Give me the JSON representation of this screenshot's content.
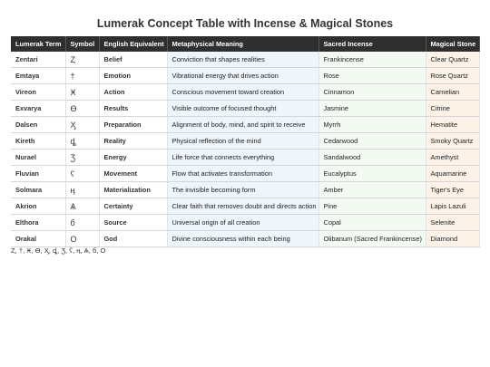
{
  "title": "Lumerak Concept Table with Incense & Magical Stones",
  "table": {
    "headers": [
      "Lumerak Term",
      "Symbol",
      "English Equivalent",
      "Metaphysical Meaning",
      "Sacred Incense",
      "Magical Stone"
    ],
    "rows": [
      {
        "term": "Zentari",
        "symbol": "Ȥ",
        "equiv": "Belief",
        "meaning": "Conviction that shapes realities",
        "incense": "Frankincense",
        "stone": "Clear Quartz"
      },
      {
        "term": "Emtaya",
        "symbol": "†",
        "equiv": "Emotion",
        "meaning": "Vibrational energy that drives action",
        "incense": "Rose",
        "stone": "Rose Quartz"
      },
      {
        "term": "Vireon",
        "symbol": "Ӿ",
        "equiv": "Action",
        "meaning": "Conscious movement toward creation",
        "incense": "Cinnamon",
        "stone": "Carnelian"
      },
      {
        "term": "Exvarya",
        "symbol": "ϴ",
        "equiv": "Results",
        "meaning": "Visible outcome of focused thought",
        "incense": "Jasmine",
        "stone": "Citrine"
      },
      {
        "term": "Dalsen",
        "symbol": "Ӽ",
        "equiv": "Preparation",
        "meaning": "Alignment of body, mind, and spirit to receive",
        "incense": "Myrrh",
        "stone": "Hematite"
      },
      {
        "term": "Kireth",
        "symbol": "ȡ",
        "equiv": "Reality",
        "meaning": "Physical reflection of the mind",
        "incense": "Cedarwood",
        "stone": "Smoky Quartz"
      },
      {
        "term": "Nurael",
        "symbol": "Ʒ",
        "equiv": "Energy",
        "meaning": "Life force that connects everything",
        "incense": "Sandalwood",
        "stone": "Amethyst"
      },
      {
        "term": "Fluvian",
        "symbol": "ʕ",
        "equiv": "Movement",
        "meaning": "Flow that activates transformation",
        "incense": "Eucalyptus",
        "stone": "Aquamarine"
      },
      {
        "term": "Solmara",
        "symbol": "ӊ",
        "equiv": "Materialization",
        "meaning": "The invisible becoming form",
        "incense": "Amber",
        "stone": "Tiger's Eye"
      },
      {
        "term": "Akrion",
        "symbol": "Ѧ",
        "equiv": "Certainty",
        "meaning": "Clear faith that removes doubt and directs action",
        "incense": "Pine",
        "stone": "Lapis Lazuli"
      },
      {
        "term": "Elthora",
        "symbol": "б",
        "equiv": "Source",
        "meaning": "Universal origin of all creation",
        "incense": "Copal",
        "stone": "Selenite"
      },
      {
        "term": "Orakal",
        "symbol": "О",
        "equiv": "God",
        "meaning": "Divine consciousness within each being",
        "incense": "Olibanum (Sacred Frankincense)",
        "stone": "Diamond"
      }
    ]
  },
  "footer": "Ȥ, †, Ӿ, ϴ, Ӽ, ȡ, Ʒ, ʕ, ӊ, Ѧ, б, О"
}
